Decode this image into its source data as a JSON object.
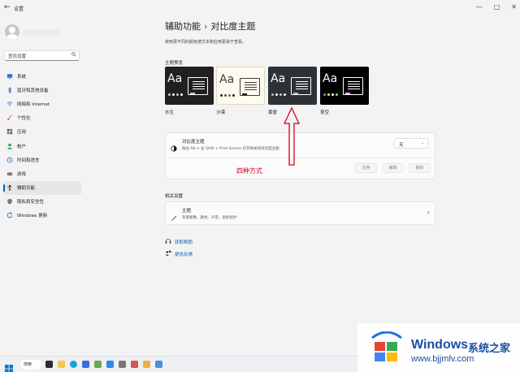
{
  "window": {
    "back_glyph": "←",
    "app_title": "设置",
    "min_glyph": "—",
    "max_glyph": "□",
    "close_glyph": "✕"
  },
  "sidebar": {
    "search_placeholder": "查找设置",
    "items": [
      {
        "label": "系统",
        "icon": "monitor-icon"
      },
      {
        "label": "蓝牙和其他设备",
        "icon": "bluetooth-icon"
      },
      {
        "label": "网络和 Internet",
        "icon": "wifi-icon"
      },
      {
        "label": "个性化",
        "icon": "brush-icon"
      },
      {
        "label": "应用",
        "icon": "apps-icon"
      },
      {
        "label": "帐户",
        "icon": "person-icon"
      },
      {
        "label": "时间和语言",
        "icon": "clock-icon"
      },
      {
        "label": "游戏",
        "icon": "gamepad-icon"
      },
      {
        "label": "辅助功能",
        "icon": "accessibility-icon",
        "selected": true
      },
      {
        "label": "隐私和安全性",
        "icon": "shield-icon"
      },
      {
        "label": "Windows 更新",
        "icon": "update-icon"
      }
    ]
  },
  "main": {
    "breadcrumb_parent": "辅助功能",
    "breadcrumb_sep": "›",
    "breadcrumb_current": "对比度主题",
    "description": "使用更不同的颜色使文本和应用更易于查看。",
    "preview_label": "主题预览",
    "preview_glyph": "Aa",
    "themes": [
      {
        "name": "水生",
        "bg": "#202020",
        "fg": "#ffffff"
      },
      {
        "name": "沙漠",
        "bg": "#fffaef",
        "fg": "#3d3d3d"
      },
      {
        "name": "黄昏",
        "bg": "#2d3236",
        "fg": "#ffffff"
      },
      {
        "name": "夜空",
        "bg": "#000000",
        "fg": "#ffffff"
      }
    ],
    "contrast_card": {
      "title": "对比度主题",
      "subtitle": "按左 Alt + 左 Shift + Print Screen 打开和关闭对比度主题",
      "dropdown_value": "无",
      "apply_label": "应用",
      "edit_label": "编辑",
      "delete_label": "删除"
    },
    "related_title": "相关设置",
    "theme_card": {
      "title": "主题",
      "subtitle": "背景图像、颜色、声音、鼠标指针"
    },
    "help_link": "获取帮助",
    "feedback_link": "提供反馈"
  },
  "annotation": {
    "text": "四种方式",
    "color": "#d0021b"
  },
  "taskbar": {
    "search_label": "搜索"
  },
  "watermark": {
    "brand": "Windows",
    "cn_text": "系统之家",
    "url": "www.bjjmlv.com"
  },
  "colors": {
    "accent": "#005fb8"
  }
}
